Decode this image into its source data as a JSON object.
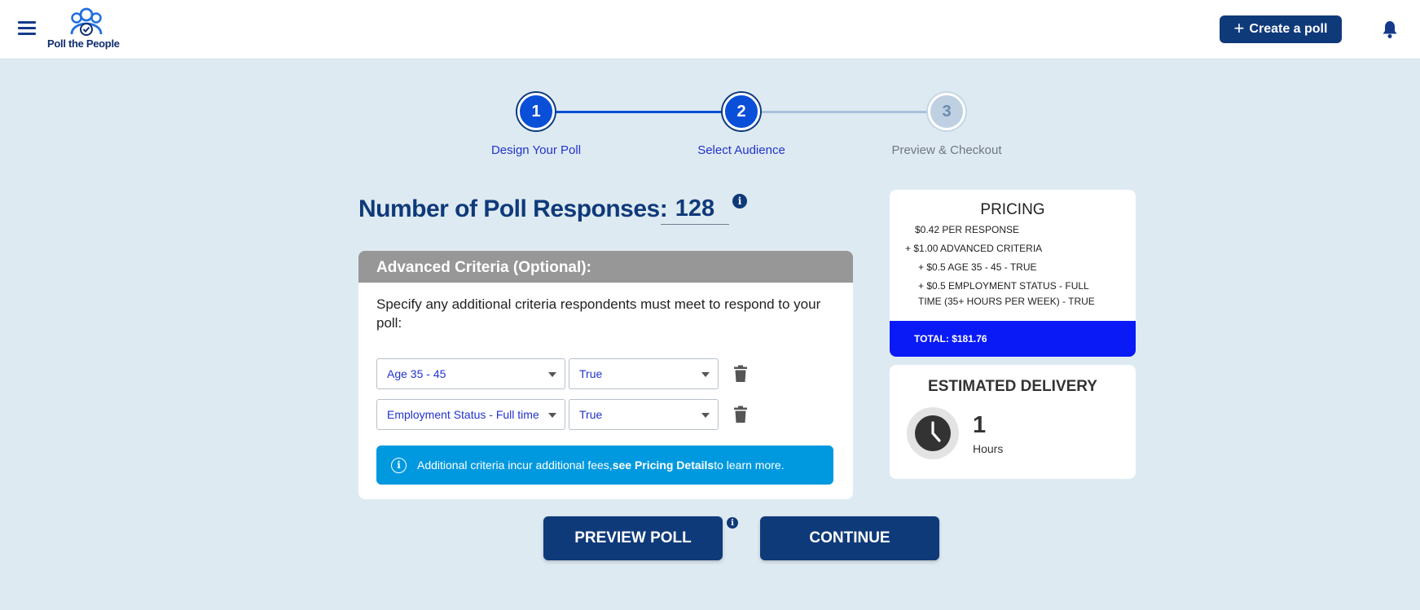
{
  "header": {
    "logo_text": "Poll the People",
    "create_poll_label": "Create a poll"
  },
  "stepper": {
    "steps": [
      {
        "number": "1",
        "label": "Design Your Poll",
        "state": "complete"
      },
      {
        "number": "2",
        "label": "Select Audience",
        "state": "active"
      },
      {
        "number": "3",
        "label": "Preview & Checkout",
        "state": "inactive"
      }
    ]
  },
  "responses": {
    "label": "Number of Poll Responses:",
    "value": "128"
  },
  "advanced": {
    "title": "Advanced Criteria (Optional):",
    "description": "Specify any additional criteria respondents must meet to respond to your poll:",
    "criteria": [
      {
        "criterion": "Age 35 - 45",
        "value": "True"
      },
      {
        "criterion": "Employment Status - Full time",
        "value": "True"
      }
    ],
    "notice": {
      "text_before": "Additional criteria incur additional fees,",
      "link": "see Pricing Details",
      "text_after": " to learn more."
    }
  },
  "pricing": {
    "title": "PRICING",
    "lines": [
      "$0.42 PER RESPONSE",
      "+ $1.00 ADVANCED CRITERIA",
      "+ $0.5 AGE 35 - 45 - TRUE",
      "+ $0.5 EMPLOYMENT STATUS - FULL",
      "TIME (35+ HOURS PER WEEK) - TRUE"
    ],
    "total": "TOTAL: $181.76"
  },
  "delivery": {
    "title": "ESTIMATED DELIVERY",
    "value": "1",
    "unit": "Hours"
  },
  "buttons": {
    "preview": "PREVIEW POLL",
    "continue": "CONTINUE"
  },
  "colors": {
    "primary": "#0f3a7a",
    "step_active": "#0a4fd8",
    "notice": "#0099e0",
    "total_bar": "#0a1af7",
    "card_header": "#979797",
    "background": "#deeaf1"
  }
}
